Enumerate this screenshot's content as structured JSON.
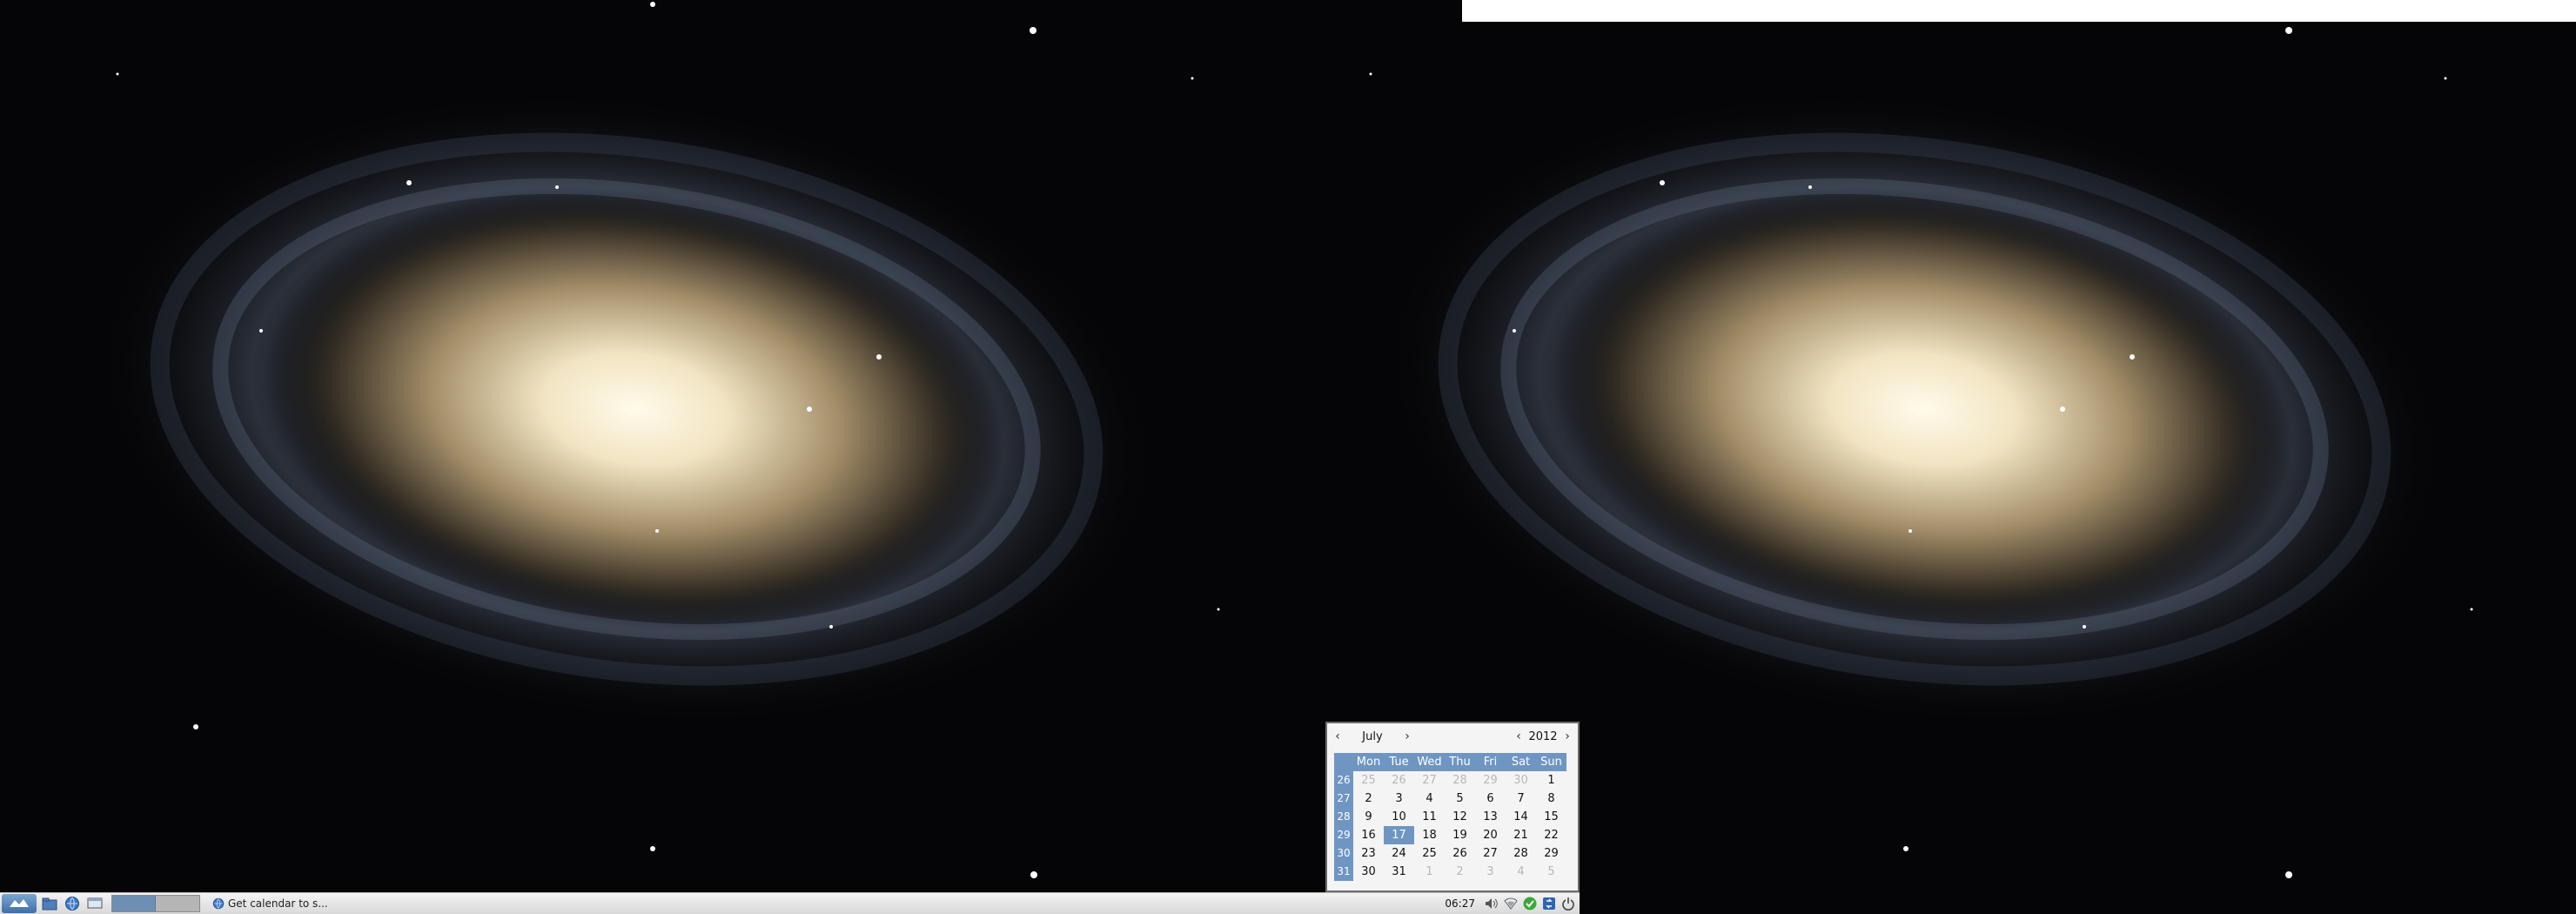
{
  "taskbar": {
    "task_label": "Get calendar to s...",
    "clock": "06:27"
  },
  "calendar": {
    "prev_month": "‹",
    "month": "July",
    "next_month": "›",
    "prev_year": "‹",
    "year": "2012",
    "next_year": "›",
    "day_headers": [
      "Mon",
      "Tue",
      "Wed",
      "Thu",
      "Fri",
      "Sat",
      "Sun"
    ],
    "weeks": [
      {
        "num": "26",
        "days": [
          "25",
          "26",
          "27",
          "28",
          "29",
          "30",
          "1"
        ]
      },
      {
        "num": "27",
        "days": [
          "2",
          "3",
          "4",
          "5",
          "6",
          "7",
          "8"
        ]
      },
      {
        "num": "28",
        "days": [
          "9",
          "10",
          "11",
          "12",
          "13",
          "14",
          "15"
        ]
      },
      {
        "num": "29",
        "days": [
          "16",
          "17",
          "18",
          "19",
          "20",
          "21",
          "22"
        ]
      },
      {
        "num": "30",
        "days": [
          "23",
          "24",
          "25",
          "26",
          "27",
          "28",
          "29"
        ]
      },
      {
        "num": "31",
        "days": [
          "30",
          "31",
          "1",
          "2",
          "3",
          "4",
          "5"
        ]
      }
    ],
    "selected_day": "17"
  },
  "colors": {
    "calendar_accent": "#6f96c2",
    "taskbar_bg": "#e6e6e6",
    "desktop_bg": "#000000"
  },
  "icons": {
    "menu": "start-menu-icon",
    "launchers": [
      "file-manager-icon",
      "browser-icon",
      "show-desktop-icon"
    ],
    "tray": [
      "volume-icon",
      "network-icon",
      "update-ok-icon",
      "sync-icon",
      "power-icon"
    ]
  }
}
